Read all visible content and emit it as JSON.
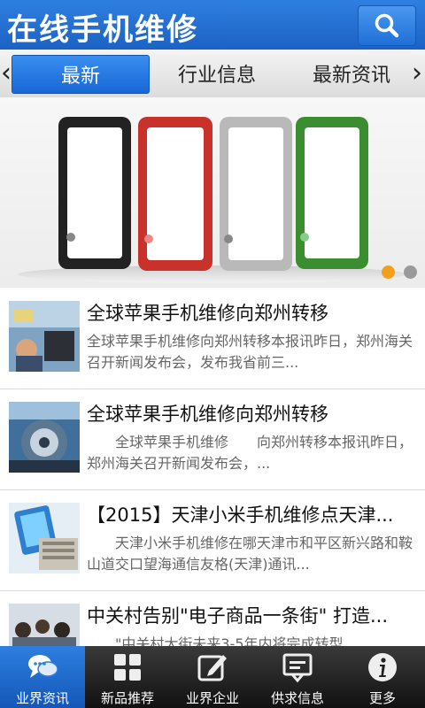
{
  "header": {
    "title": "在线手机维修",
    "search_icon": "search-icon"
  },
  "tabs": [
    {
      "label": "最新",
      "active": true
    },
    {
      "label": "行业信息",
      "active": false
    },
    {
      "label": "最新资讯",
      "active": false
    }
  ],
  "banner": {
    "slide_count": 2,
    "active_slide": 1,
    "dot_active_color": "#f2a01a",
    "dot_color": "#9a9a9a"
  },
  "news": [
    {
      "title": "全球苹果手机维修向郑州转移",
      "summary": "全球苹果手机维修向郑州转移本报讯昨日，郑州海关召开新闻发布会，发布我省前三..."
    },
    {
      "title": "全球苹果手机维修向郑州转移",
      "summary": "　　全球苹果手机维修　　向郑州转移本报讯昨日，郑州海关召开新闻发布会，..."
    },
    {
      "title": "【2015】天津小米手机维修点天津...",
      "summary": "　　天津小米手机维修在哪天津市和平区新兴路和鞍山道交口望海通信友格(天津)通讯..."
    },
    {
      "title": "中关村告别\"电子商品一条街\" 打造...",
      "summary": "　　\"中关村大街未来3-5年内将完成转型"
    }
  ],
  "bottom_nav": [
    {
      "label": "业界资讯",
      "icon": "chat-bubbles-icon",
      "active": true
    },
    {
      "label": "新品推荐",
      "icon": "grid-icon",
      "active": false
    },
    {
      "label": "业界企业",
      "icon": "edit-icon",
      "active": false
    },
    {
      "label": "供求信息",
      "icon": "message-box-icon",
      "active": false
    },
    {
      "label": "更多",
      "icon": "info-icon",
      "active": false
    }
  ],
  "colors": {
    "header_blue": "#1b62c4",
    "active_blue": "#2c7fe0"
  }
}
